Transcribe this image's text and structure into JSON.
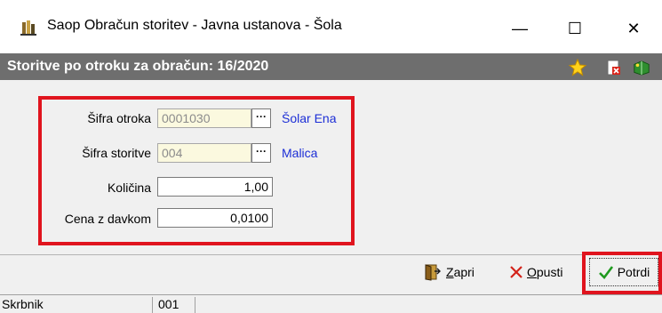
{
  "window": {
    "title": "Saop Obračun storitev - Javna ustanova - Šola",
    "minimize_glyph": "—",
    "maximize_glyph": "☐",
    "close_glyph": "✕"
  },
  "header": {
    "title": "Storitve po otroku za obračun: 16/2020",
    "icons": [
      "star-icon",
      "delete-document-icon",
      "book-icon"
    ]
  },
  "form": {
    "child_code": {
      "label": "Šifra otroka",
      "value": "0001030",
      "linked_name": "Šolar Ena"
    },
    "service_code": {
      "label": "Šifra storitve",
      "value": "004",
      "linked_name": "Malica"
    },
    "quantity": {
      "label": "Količina",
      "value": "1,00"
    },
    "price": {
      "label": "Cena z davkom",
      "value": "0,0100"
    },
    "lookup_glyph": "···"
  },
  "toolbar": {
    "close": {
      "accel": "Z",
      "rest": "apri"
    },
    "cancel": {
      "accel": "O",
      "rest": "pusti"
    },
    "confirm": {
      "accel": "P",
      "rest": "otrdi"
    }
  },
  "status_bar": {
    "cells": [
      "Skrbnik",
      "001",
      ""
    ]
  },
  "colors": {
    "highlight": "#e0141e",
    "header_bg": "#6e6e6e",
    "link": "#1c2ed6",
    "readonly_bg": "#fbf9df"
  }
}
